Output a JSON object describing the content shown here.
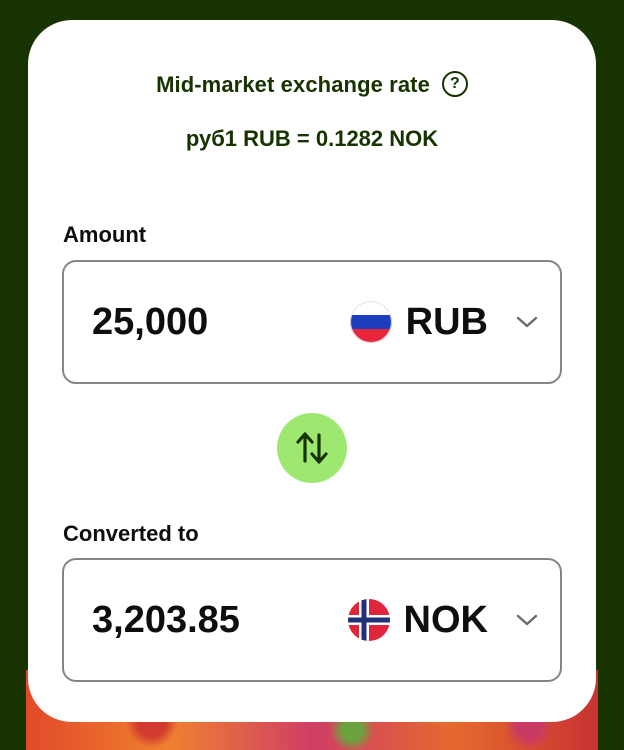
{
  "rate": {
    "title": "Mid-market exchange rate",
    "help_icon": "?",
    "value": "руб1 RUB = 0.1282 NOK"
  },
  "amount": {
    "label": "Amount",
    "value": "25,000",
    "currency": "RUB",
    "flag_icon": "russia-flag-icon"
  },
  "converted": {
    "label": "Converted to",
    "value": "3,203.85",
    "currency": "NOK",
    "flag_icon": "norway-flag-icon"
  },
  "swap_icon": "swap-arrows-icon",
  "colors": {
    "background": "#173300",
    "card": "#ffffff",
    "brand_dark": "#163300",
    "accent_green": "#9fe870",
    "border": "#868685"
  }
}
